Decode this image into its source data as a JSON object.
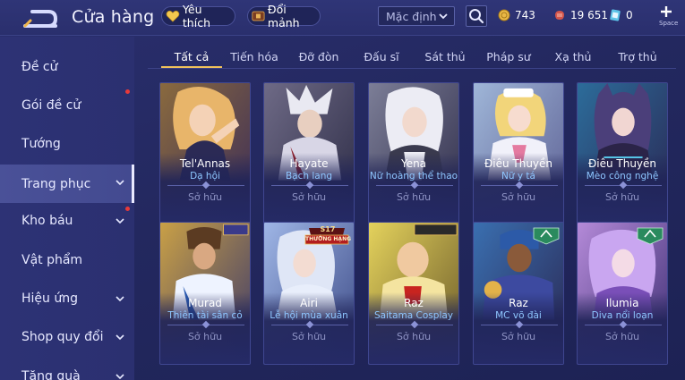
{
  "header": {
    "title": "Cửa hàng",
    "favorite_label": "Yêu thích",
    "fragment_label": "Đổi mảnh",
    "sort_value": "Mặc định",
    "gold": "743",
    "vouchers": "19 651",
    "tickets": "0",
    "space_label": "Space"
  },
  "sidebar": {
    "items": [
      {
        "label": "Đề cử"
      },
      {
        "label": "Gói đề cử"
      },
      {
        "label": "Tướng"
      },
      {
        "label": "Trang phục"
      },
      {
        "label": "Kho báu"
      },
      {
        "label": "Vật phẩm"
      },
      {
        "label": "Hiệu ứng"
      },
      {
        "label": "Shop quy đổi"
      },
      {
        "label": "Tặng quà"
      }
    ]
  },
  "tabs": [
    {
      "label": "Tất cả"
    },
    {
      "label": "Tiến hóa"
    },
    {
      "label": "Đỡ đòn"
    },
    {
      "label": "Đấu sĩ"
    },
    {
      "label": "Sát thủ"
    },
    {
      "label": "Pháp sư"
    },
    {
      "label": "Xạ thủ"
    },
    {
      "label": "Trợ thủ"
    }
  ],
  "cards": [
    {
      "hero": "Tel'Annas",
      "skin": "Dạ hội",
      "status": "Sở hữu"
    },
    {
      "hero": "Hayate",
      "skin": "Bạch lang",
      "status": "Sở hữu"
    },
    {
      "hero": "Yena",
      "skin": "Nữ hoàng thể thao",
      "status": "Sở hữu"
    },
    {
      "hero": "Điêu Thuyền",
      "skin": "Nữ y tá",
      "status": "Sở hữu"
    },
    {
      "hero": "Điêu Thuyền",
      "skin": "Mèo công nghệ",
      "status": "Sở hữu"
    },
    {
      "hero": "Murad",
      "skin": "Thiên tài sân cỏ",
      "status": "Sở hữu"
    },
    {
      "hero": "Airi",
      "skin": "Lễ hội mùa xuân",
      "status": "Sở hữu",
      "badge_top": "S17",
      "badge_bottom": "THƯỞNG HẠNG"
    },
    {
      "hero": "Raz",
      "skin": "Saitama Cosplay",
      "status": "Sở hữu"
    },
    {
      "hero": "Raz",
      "skin": "MC võ đài",
      "status": "Sở hữu"
    },
    {
      "hero": "Ilumia",
      "skin": "Diva nổi loạn",
      "status": "Sở hữu"
    }
  ],
  "colors": {
    "accent": "#f0c25b",
    "skin_name": "#8ec6ff",
    "notification": "#e83a3a"
  }
}
